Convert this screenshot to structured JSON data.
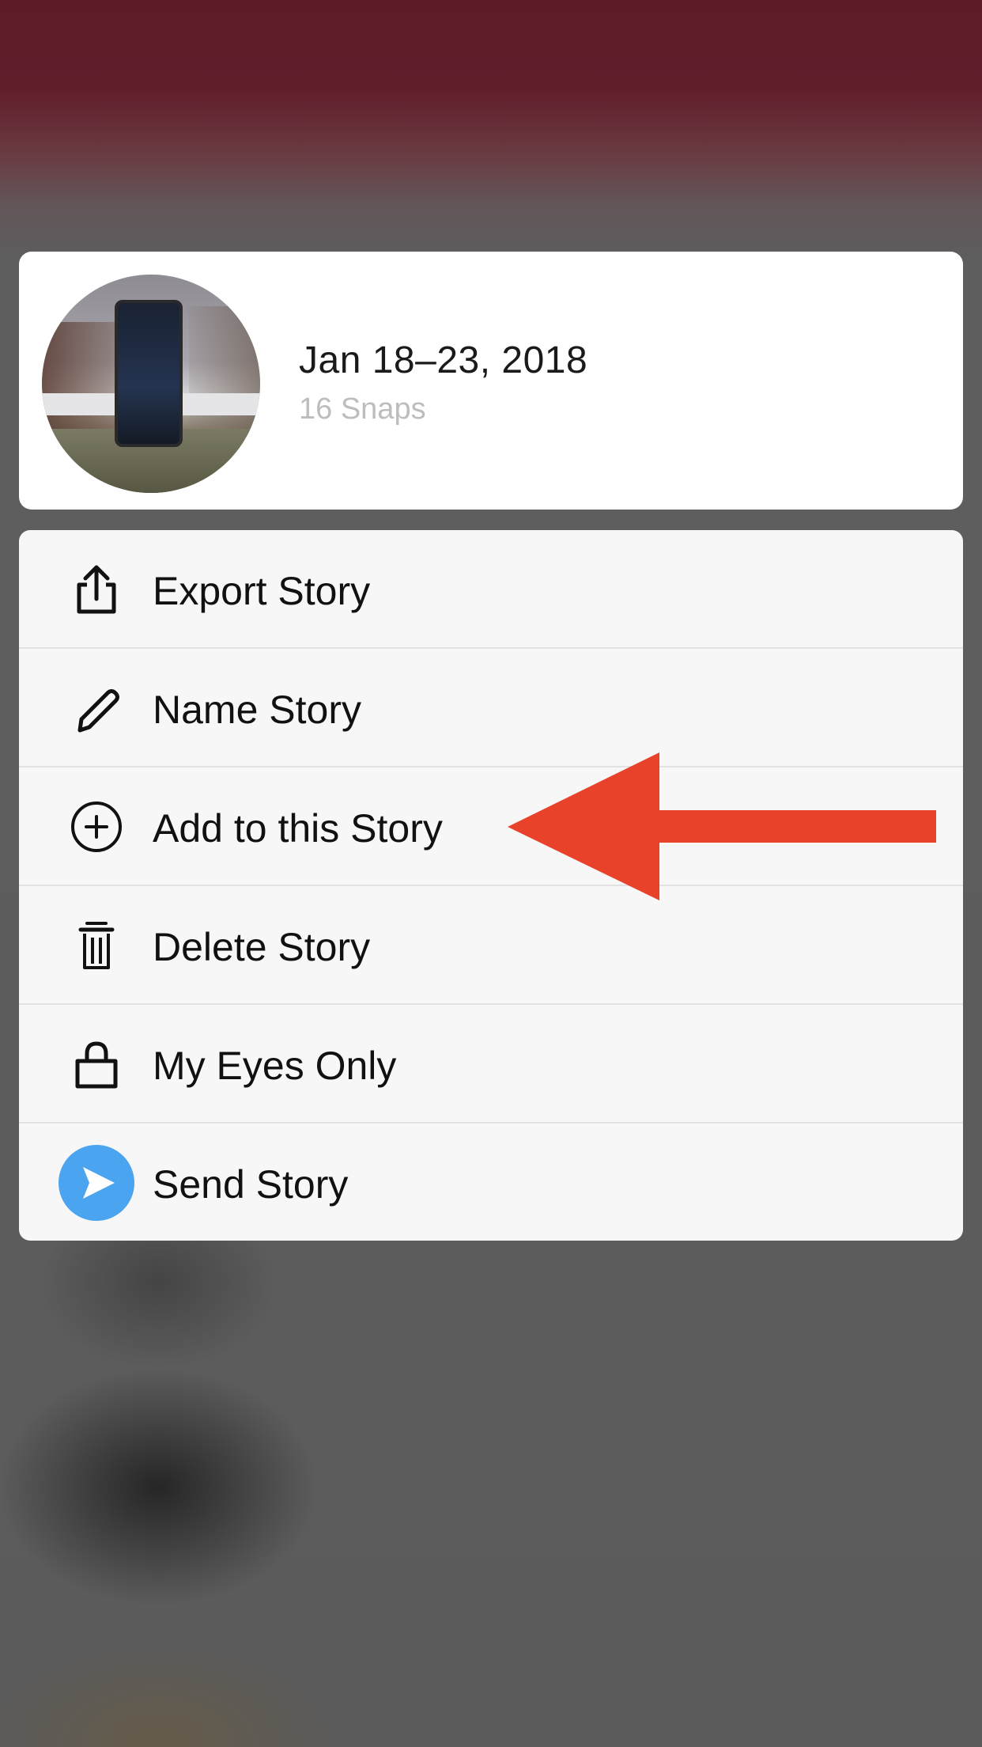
{
  "story": {
    "title": "Jan 18–23, 2018",
    "subtitle": "16 Snaps"
  },
  "menu": {
    "items": [
      {
        "label": "Export Story",
        "icon": "share-icon"
      },
      {
        "label": "Name Story",
        "icon": "pencil-icon"
      },
      {
        "label": "Add to this Story",
        "icon": "plus-circle-icon"
      },
      {
        "label": "Delete Story",
        "icon": "trash-icon"
      },
      {
        "label": "My Eyes Only",
        "icon": "lock-icon"
      },
      {
        "label": "Send Story",
        "icon": "send-icon"
      }
    ]
  },
  "colors": {
    "annotation_arrow": "#e8432a",
    "send_icon": "#4ba4f0",
    "backdrop_top": "#5d1b28"
  }
}
